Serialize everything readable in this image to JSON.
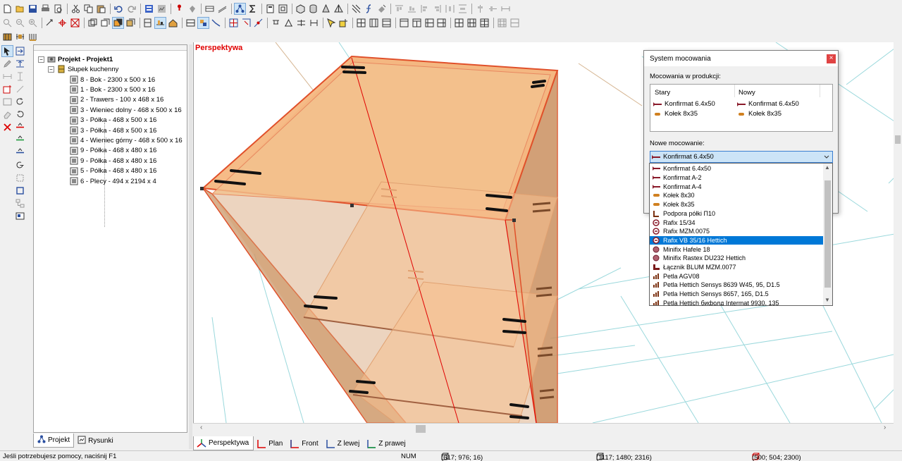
{
  "viewport": {
    "title": "Perspektywa"
  },
  "tree": {
    "root": "Projekt - Projekt1",
    "group": "Słupek kuchenny",
    "items": [
      "8 - Bok - 2300 x 500 x 16",
      "1 - Bok - 2300 x 500 x 16",
      "2 - Trawers - 100 x 468 x 16",
      "3 - Wieniec dolny - 468 x 500 x 16",
      "3 - Półka - 468 x 500 x 16",
      "3 - Półka - 468 x 500 x 16",
      "4 - Wieniec górny - 468 x 500 x 16",
      "9 - Półka - 468 x 480 x 16",
      "9 - Półka - 468 x 480 x 16",
      "5 - Półka - 468 x 480 x 16",
      "6 - Plecy - 494 x 2194 x 4"
    ]
  },
  "left_tabs": {
    "project": "Projekt",
    "drawings": "Rysunki"
  },
  "view_tabs": [
    "Perspektywa",
    "Plan",
    "Front",
    "Z lewej",
    "Z prawej"
  ],
  "dialog": {
    "title": "System mocowania",
    "production_label": "Mocowania w produkcji:",
    "col_old": "Stary",
    "col_new": "Nowy",
    "rows": [
      {
        "old": "Konfirmat 6.4x50",
        "new": "Konfirmat 6.4x50"
      },
      {
        "old": "Kołek 8x35",
        "new": "Kołek 8x35"
      }
    ],
    "new_label": "Nowe mocowanie:",
    "combo_value": "Konfirmat 6.4x50",
    "options": [
      "Konfirmat 6.4x50",
      "Konfirmat A-2",
      "Konfirmat A-4",
      "Kołek 8x30",
      "Kołek 8x35",
      "Podpora półki П10",
      "Rafix 15/34",
      "Rafix MZM.0075",
      "Rafix VB 35/16 Hettich",
      "Minifix Hafele 18",
      "Minifix Rastex DU232 Hettich",
      "Łącznik BLUM MZM.0077",
      "Petla AGV08",
      "Petla Hettich Sensys 8639 W45, 95, D1.5",
      "Petla Hettich Sensys 8657, 165, D1.5",
      "Petla Hettich бифолд Intermat 9930, 135"
    ],
    "selected_option": "Rafix VB 35/16 Hettich"
  },
  "status": {
    "help": "Jeśli potrzebujesz pomocy, naciśnij F1",
    "num": "NUM",
    "coord1": "(617; 976; 16)",
    "coord2": "(1117; 1480; 2316)",
    "coord3": "(500; 504; 2300)"
  },
  "colors": {
    "accent_red": "#e00000",
    "cabinet_fill": "#f5b47a",
    "cabinet_edge": "#e0502a",
    "grid": "#9ad8dc",
    "selection": "#0078d7"
  }
}
